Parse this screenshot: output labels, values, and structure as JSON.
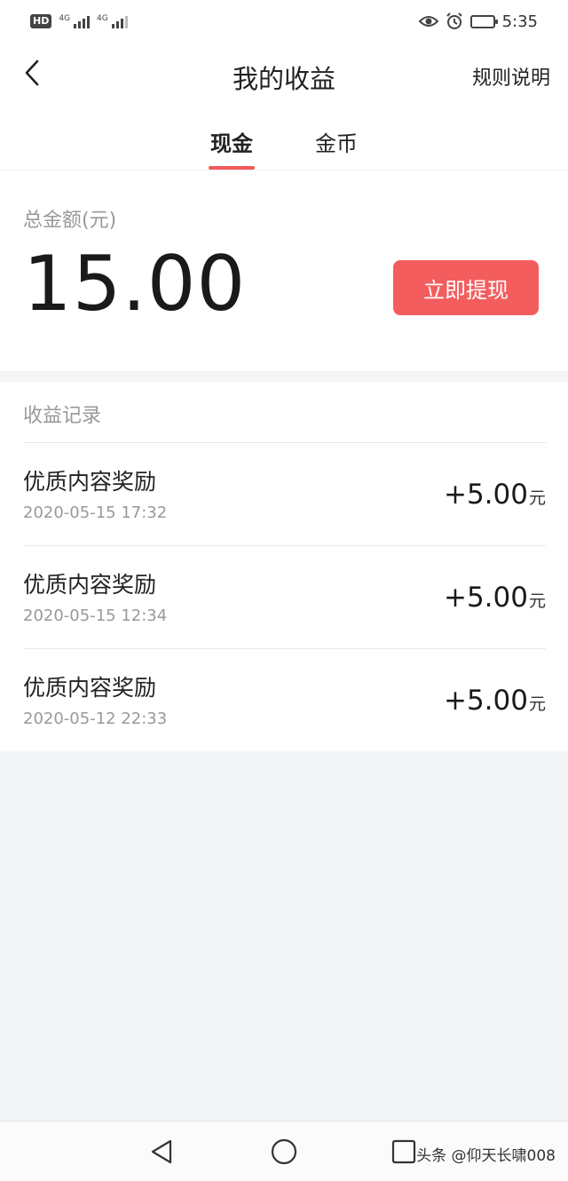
{
  "status_bar": {
    "hd": "HD",
    "sim1_net": "4G",
    "sim2_net": "4G",
    "time": "5:35",
    "battery_level": 0.9,
    "icons": [
      "eye-icon",
      "alarm-icon",
      "battery-icon"
    ]
  },
  "nav": {
    "back_icon": "chevron-left-icon",
    "title": "我的收益",
    "rules_label": "规则说明"
  },
  "tabs": [
    {
      "label": "现金",
      "active": true
    },
    {
      "label": "金币",
      "active": false
    }
  ],
  "balance": {
    "label": "总金额(元)",
    "amount": "15.00",
    "withdraw_label": "立即提现"
  },
  "records": {
    "header": "收益记录",
    "unit": "元",
    "items": [
      {
        "title": "优质内容奖励",
        "time": "2020-05-15 17:32",
        "amount": "+5.00"
      },
      {
        "title": "优质内容奖励",
        "time": "2020-05-15 12:34",
        "amount": "+5.00"
      },
      {
        "title": "优质内容奖励",
        "time": "2020-05-12 22:33",
        "amount": "+5.00"
      }
    ]
  },
  "system_nav": {
    "icons": [
      "back-triangle-icon",
      "home-circle-icon",
      "recents-square-icon"
    ]
  },
  "watermark": "头条 @仰天长啸008",
  "colors": {
    "accent": "#f45d5d",
    "tab_indicator": "#f25a5a",
    "background": "#f4f5f7"
  }
}
